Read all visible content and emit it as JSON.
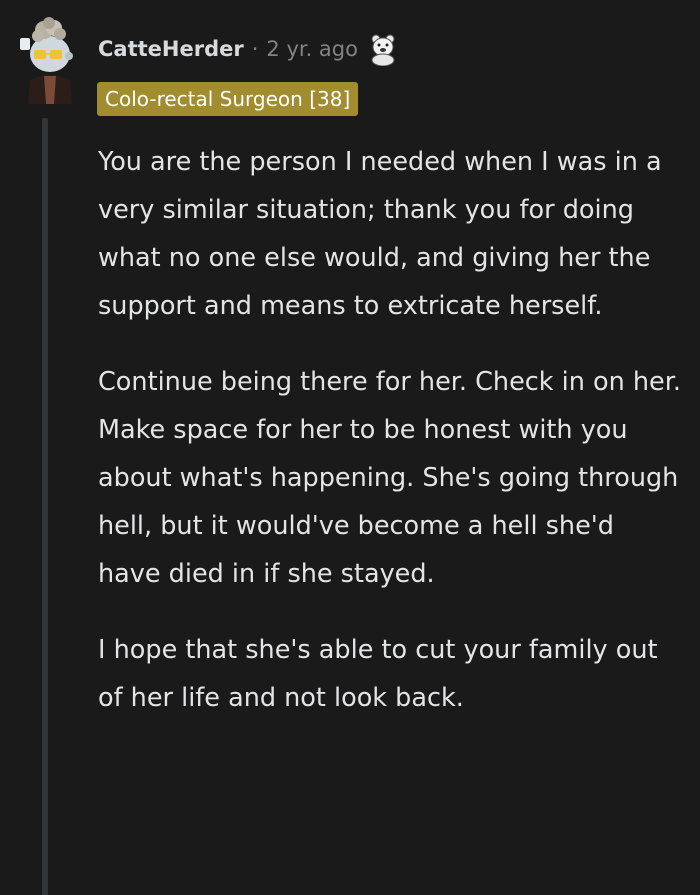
{
  "comment": {
    "username": "CatteHerder",
    "separator": "·",
    "timestamp": "2 yr. ago",
    "award_icon": "polar-bear-award-icon",
    "flair": "Colo-rectal Surgeon [38]",
    "paragraphs": [
      "You are the person I needed when I was in a very similar situation; thank you for doing what no one else would, and giving her the support and means to extricate herself.",
      "Continue being there for her. Check in on her. Make space for her to be honest with you about what's happening. She's going through hell, but it would've become a hell she'd have died in if she stayed.",
      "I hope that she's able to cut your family out of her life and not look back."
    ]
  },
  "colors": {
    "background": "#1a1a1b",
    "flair_bg": "#a28c30",
    "thread_line": "#343536",
    "meta_text": "#818384"
  }
}
